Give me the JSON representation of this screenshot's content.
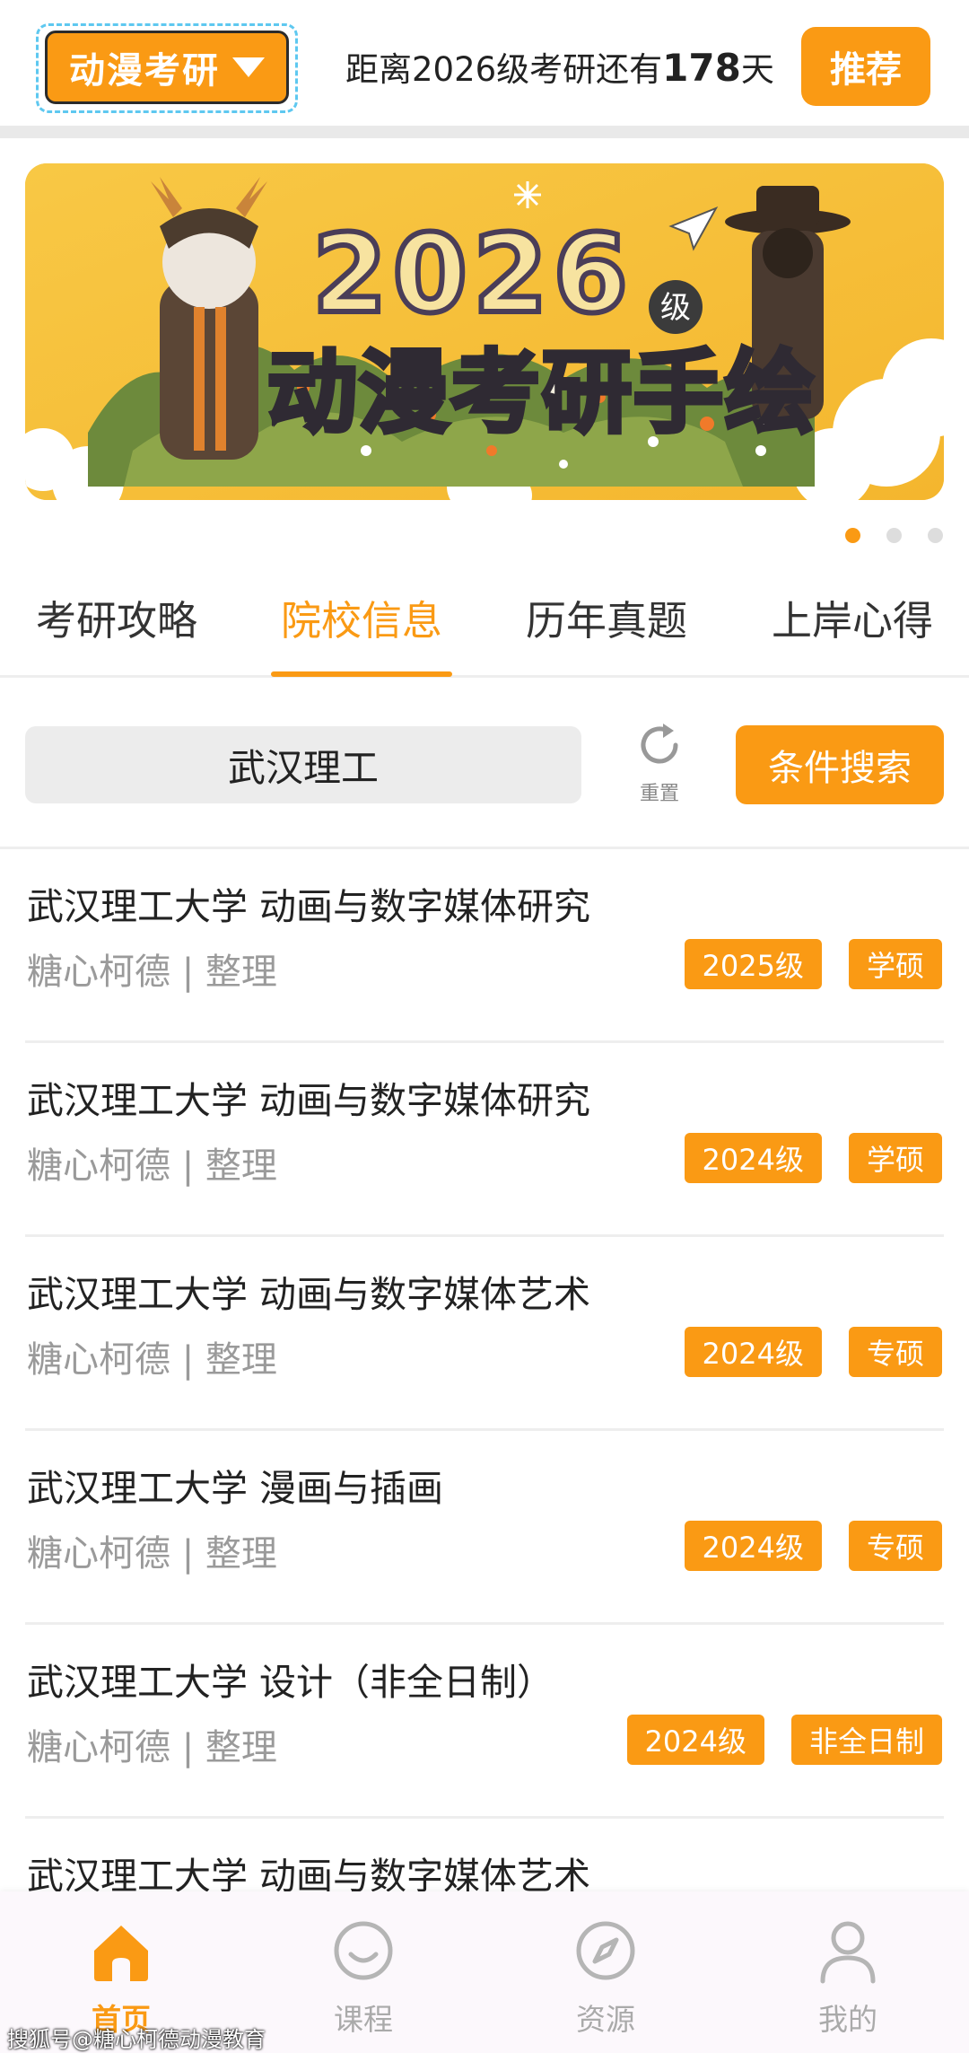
{
  "header": {
    "brand": "动漫考研",
    "countdown_prefix": "距离2026级考研还有",
    "countdown_days": "178",
    "countdown_suffix": "天",
    "recommend": "推荐"
  },
  "banner": {
    "year": "2026",
    "grade": "级",
    "title": "动漫考研手绘",
    "dots": 3,
    "active_dot": 0
  },
  "tabs": [
    {
      "label": "考研攻略"
    },
    {
      "label": "院校信息"
    },
    {
      "label": "历年真题"
    },
    {
      "label": "上岸心得"
    }
  ],
  "active_tab": 1,
  "search": {
    "value": "武汉理工",
    "reset": "重置",
    "condition_search": "条件搜索"
  },
  "list": [
    {
      "title": "武汉理工大学 动画与数字媒体研究",
      "author": "糖心柯德",
      "sep": "|",
      "action": "整理",
      "tags": [
        "2025级",
        "学硕"
      ]
    },
    {
      "title": "武汉理工大学 动画与数字媒体研究",
      "author": "糖心柯德",
      "sep": "|",
      "action": "整理",
      "tags": [
        "2024级",
        "学硕"
      ]
    },
    {
      "title": "武汉理工大学 动画与数字媒体艺术",
      "author": "糖心柯德",
      "sep": "|",
      "action": "整理",
      "tags": [
        "2024级",
        "专硕"
      ]
    },
    {
      "title": "武汉理工大学 漫画与插画",
      "author": "糖心柯德",
      "sep": "|",
      "action": "整理",
      "tags": [
        "2024级",
        "专硕"
      ]
    },
    {
      "title": "武汉理工大学 设计（非全日制）",
      "author": "糖心柯德",
      "sep": "|",
      "action": "整理",
      "tags": [
        "2024级",
        "非全日制"
      ]
    },
    {
      "title": "武汉理工大学 动画与数字媒体艺术",
      "author": "",
      "sep": "",
      "action": "",
      "tags": []
    }
  ],
  "nav": [
    {
      "label": "首页",
      "icon": "home-icon",
      "active": true
    },
    {
      "label": "课程",
      "icon": "smile-icon",
      "active": false
    },
    {
      "label": "资源",
      "icon": "compass-icon",
      "active": false
    },
    {
      "label": "我的",
      "icon": "user-icon",
      "active": false
    }
  ],
  "watermark": "搜狐号@糖心柯德动漫教育",
  "colors": {
    "accent": "#fa9a14",
    "muted": "#9a9a9a",
    "divider": "#eeeeee"
  }
}
